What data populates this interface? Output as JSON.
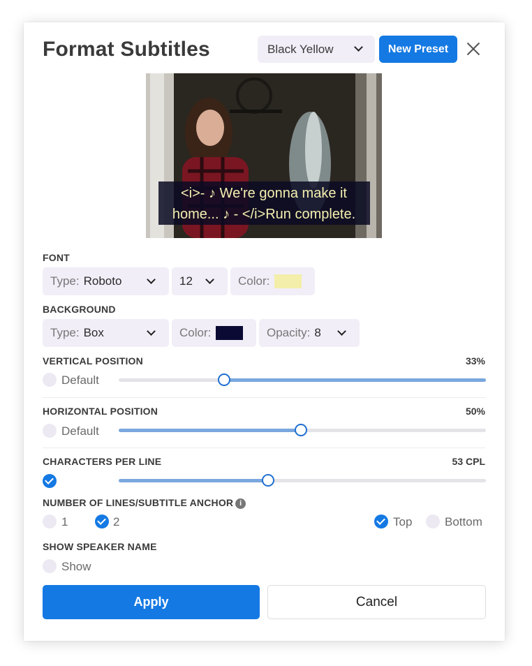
{
  "dialog": {
    "title": "Format Subtitles",
    "preset_value": "Black Yellow",
    "new_preset_label": "New Preset"
  },
  "preview": {
    "line1": "<i>- ♪ We're gonna make it",
    "line2": "home... ♪ - </i>Run complete."
  },
  "font": {
    "label": "FONT",
    "type_label": "Type:",
    "type_value": "Roboto",
    "size_value": "12",
    "color_label": "Color:",
    "color": "#f3eeaa"
  },
  "background": {
    "label": "BACKGROUND",
    "type_label": "Type:",
    "type_value": "Box",
    "color_label": "Color:",
    "color": "#0b0a35",
    "opacity_label": "Opacity:",
    "opacity_value": "8"
  },
  "vertical_position": {
    "label": "VERTICAL POSITION",
    "value_text": "33%",
    "value": 0.29,
    "default_label": "Default",
    "default_checked": false
  },
  "horizontal_position": {
    "label": "HORIZONTAL POSITION",
    "value_text": "50%",
    "value": 0.5,
    "default_label": "Default",
    "default_checked": false
  },
  "characters_per_line": {
    "label": "CHARACTERS PER LINE",
    "value_text": "53 CPL",
    "value": 0.41,
    "checked": true
  },
  "lines_anchor": {
    "label": "NUMBER OF LINES/SUBTITLE ANCHOR",
    "info_glyph": "i",
    "option_1": "1",
    "option_2": "2",
    "top_label": "Top",
    "bottom_label": "Bottom"
  },
  "speaker": {
    "label": "SHOW SPEAKER NAME",
    "show_label": "Show"
  },
  "buttons": {
    "apply": "Apply",
    "cancel": "Cancel"
  },
  "colors": {
    "accent": "#1479e3",
    "slider_fill": "#7aa7de",
    "chip_bg": "#f1eef7"
  }
}
